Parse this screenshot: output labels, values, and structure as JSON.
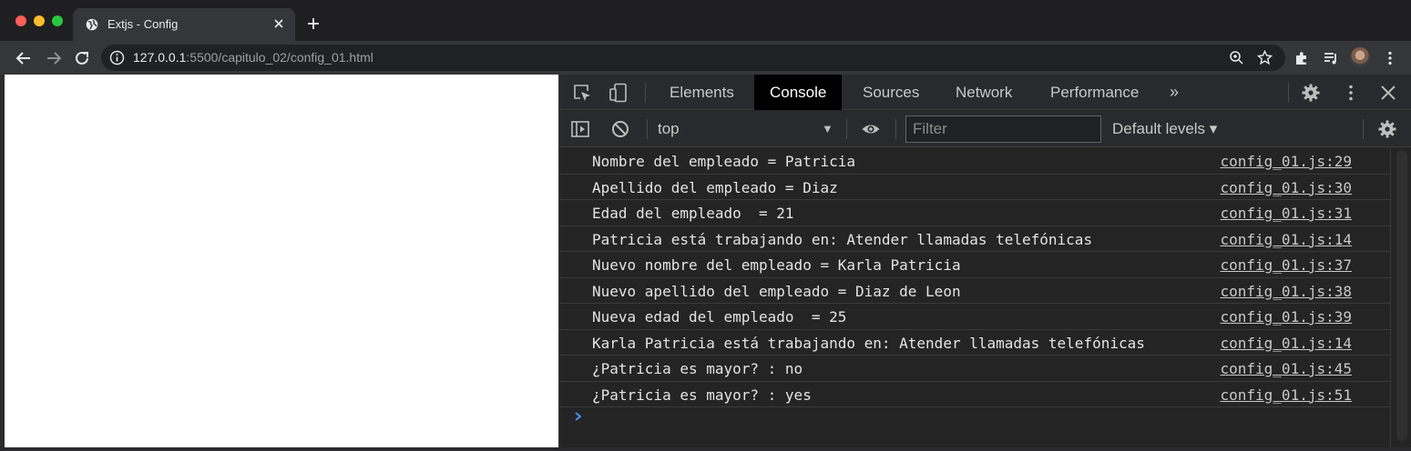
{
  "browser": {
    "tab_title": "Extjs - Config",
    "url_host": "127.0.0.1",
    "url_path": ":5500/capitulo_02/config_01.html"
  },
  "devtools": {
    "tabs": [
      {
        "label": "Elements"
      },
      {
        "label": "Console"
      },
      {
        "label": "Sources"
      },
      {
        "label": "Network"
      },
      {
        "label": "Performance"
      }
    ],
    "active_tab": "Console",
    "more_tabs": "»",
    "context": "top",
    "filter_placeholder": "Filter",
    "levels": "Default levels ▾",
    "messages": [
      {
        "text": "Nombre del empleado = Patricia",
        "source": "config_01.js:29"
      },
      {
        "text": "Apellido del empleado = Diaz",
        "source": "config_01.js:30"
      },
      {
        "text": "Edad del empleado  = 21",
        "source": "config_01.js:31"
      },
      {
        "text": "Patricia está trabajando en: Atender llamadas telefónicas",
        "source": "config_01.js:14"
      },
      {
        "text": "Nuevo nombre del empleado = Karla Patricia",
        "source": "config_01.js:37"
      },
      {
        "text": "Nuevo apellido del empleado = Diaz de Leon",
        "source": "config_01.js:38"
      },
      {
        "text": "Nueva edad del empleado  = 25",
        "source": "config_01.js:39"
      },
      {
        "text": "Karla Patricia está trabajando en: Atender llamadas telefónicas",
        "source": "config_01.js:14"
      },
      {
        "text": "¿Patricia es mayor? : no",
        "source": "config_01.js:45"
      },
      {
        "text": "¿Patricia es mayor? : yes",
        "source": "config_01.js:51"
      }
    ]
  },
  "colors": {
    "active_tab_bg": "#000000",
    "prompt_blue": "#4b8cf5",
    "traffic_red": "#fe5f57",
    "traffic_yellow": "#febc2e",
    "traffic_green": "#28c840"
  }
}
